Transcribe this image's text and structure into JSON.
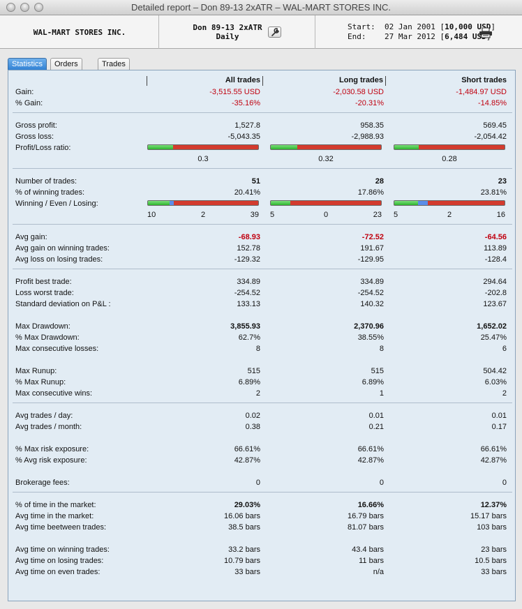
{
  "window": {
    "title": "Detailed report – Don 89-13 2xATR – WAL-MART STORES INC."
  },
  "header": {
    "stock": "WAL-MART STORES INC.",
    "system": "Don 89-13 2xATR",
    "period": "Daily",
    "start_label": "Start:",
    "start_date": "02 Jan 2001",
    "start_capital": "10,000 USD",
    "end_label": "End:",
    "end_date": "27 Mar 2012",
    "end_capital": "6,484 USD"
  },
  "tabs": [
    "Statistics",
    "Orders list",
    "Trades list"
  ],
  "columns": {
    "all": "All trades",
    "long": "Long trades",
    "short": "Short trades"
  },
  "colors": {
    "win": "#2fb52f",
    "even": "#5b8de8",
    "lose": "#c52b1c",
    "negative_text": "#c0000f"
  },
  "stats": {
    "gain": {
      "label": "Gain:",
      "all": "-3,515.55 USD",
      "long": "-2,030.58 USD",
      "short": "-1,484.97 USD"
    },
    "pct_gain": {
      "label": "% Gain:",
      "all": "-35.16%",
      "long": "-20.31%",
      "short": "-14.85%"
    },
    "gross_profit": {
      "label": "Gross profit:",
      "all": "1,527.8",
      "long": "958.35",
      "short": "569.45"
    },
    "gross_loss": {
      "label": "Gross loss:",
      "all": "-5,043.35",
      "long": "-2,988.93",
      "short": "-2,054.42"
    },
    "pl_ratio": {
      "label": "Profit/Loss ratio:",
      "all": "0.3",
      "long": "0.32",
      "short": "0.28",
      "all_fraction": 0.23,
      "long_fraction": 0.24,
      "short_fraction": 0.22
    },
    "num_trades": {
      "label": "Number of trades:",
      "all": "51",
      "long": "28",
      "short": "23"
    },
    "pct_winning": {
      "label": "% of winning trades:",
      "all": "20.41%",
      "long": "17.86%",
      "short": "23.81%"
    },
    "wel": {
      "label": "Winning / Even / Losing:",
      "all": {
        "win": "10",
        "even": "2",
        "lose": "39"
      },
      "long": {
        "win": "5",
        "even": "0",
        "lose": "23"
      },
      "short": {
        "win": "5",
        "even": "2",
        "lose": "16"
      }
    },
    "avg_gain": {
      "label": "Avg gain:",
      "all": "-68.93",
      "long": "-72.52",
      "short": "-64.56"
    },
    "avg_gain_win": {
      "label": "Avg gain on winning trades:",
      "all": "152.78",
      "long": "191.67",
      "short": "113.89"
    },
    "avg_loss_lose": {
      "label": "Avg loss on losing trades:",
      "all": "-129.32",
      "long": "-129.95",
      "short": "-128.4"
    },
    "best_trade": {
      "label": "Profit best trade:",
      "all": "334.89",
      "long": "334.89",
      "short": "294.64"
    },
    "worst_trade": {
      "label": "Loss worst trade:",
      "all": "-254.52",
      "long": "-254.52",
      "short": "-202.8"
    },
    "std_dev": {
      "label": "Standard deviation on P&L :",
      "all": "133.13",
      "long": "140.32",
      "short": "123.67"
    },
    "max_dd": {
      "label": "Max Drawdown:",
      "all": "3,855.93",
      "long": "2,370.96",
      "short": "1,652.02"
    },
    "pct_max_dd": {
      "label": "% Max Drawdown:",
      "all": "62.7%",
      "long": "38.55%",
      "short": "25.47%"
    },
    "max_consec_losses": {
      "label": "Max consecutive losses:",
      "all": "8",
      "long": "8",
      "short": "6"
    },
    "max_runup": {
      "label": "Max Runup:",
      "all": "515",
      "long": "515",
      "short": "504.42"
    },
    "pct_max_runup": {
      "label": "% Max Runup:",
      "all": "6.89%",
      "long": "6.89%",
      "short": "6.03%"
    },
    "max_consec_wins": {
      "label": "Max consecutive wins:",
      "all": "2",
      "long": "1",
      "short": "2"
    },
    "trades_day": {
      "label": "Avg trades / day:",
      "all": "0.02",
      "long": "0.01",
      "short": "0.01"
    },
    "trades_month": {
      "label": "Avg trades / month:",
      "all": "0.38",
      "long": "0.21",
      "short": "0.17"
    },
    "max_risk": {
      "label": "% Max risk exposure:",
      "all": "66.61%",
      "long": "66.61%",
      "short": "66.61%"
    },
    "avg_risk": {
      "label": "% Avg risk exposure:",
      "all": "42.87%",
      "long": "42.87%",
      "short": "42.87%"
    },
    "brokerage": {
      "label": "Brokerage fees:",
      "all": "0",
      "long": "0",
      "short": "0"
    },
    "pct_time_market": {
      "label": "% of time in the market:",
      "all": "29.03%",
      "long": "16.66%",
      "short": "12.37%"
    },
    "avg_time_market": {
      "label": "Avg time in the market:",
      "all": "16.06 bars",
      "long": "16.79 bars",
      "short": "15.17 bars"
    },
    "avg_time_between": {
      "label": "Avg time beetween trades:",
      "all": "38.5 bars",
      "long": "81.07 bars",
      "short": "103 bars"
    },
    "avg_time_win": {
      "label": "Avg time on winning trades:",
      "all": "33.2 bars",
      "long": "43.4 bars",
      "short": "23 bars"
    },
    "avg_time_lose": {
      "label": "Avg time on losing trades:",
      "all": "10.79 bars",
      "long": "11 bars",
      "short": "10.5 bars"
    },
    "avg_time_even": {
      "label": "Avg time on even trades:",
      "all": "33 bars",
      "long": "n/a",
      "short": "33 bars"
    }
  }
}
